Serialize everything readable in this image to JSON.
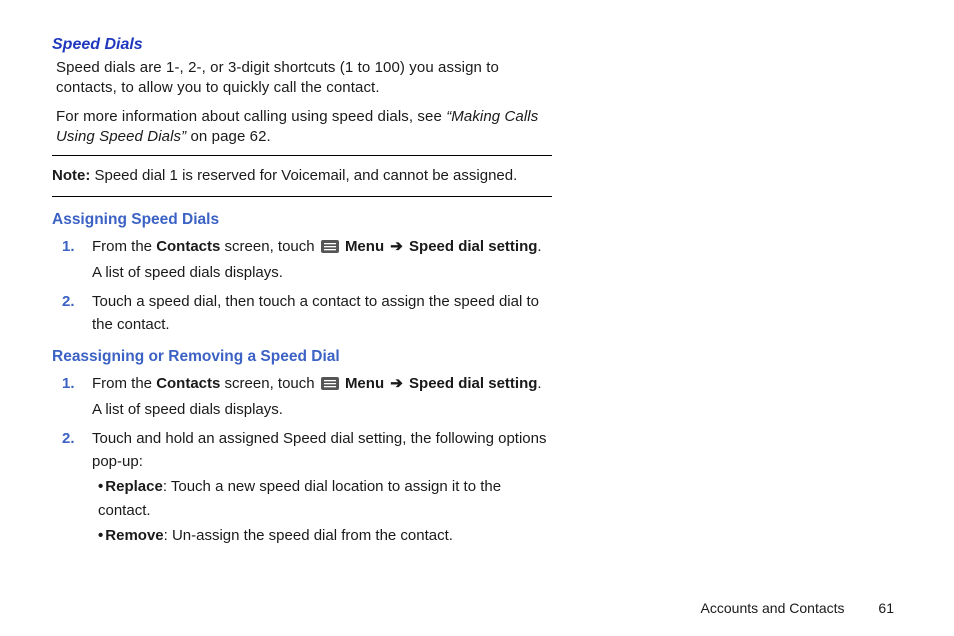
{
  "heading": "Speed Dials",
  "intro1": "Speed dials are 1-, 2-, or 3-digit shortcuts (1 to 100) you assign to contacts, to allow you to quickly call the contact.",
  "intro2_pre": "For more information about calling using speed dials, see ",
  "intro2_ref": "“Making Calls Using Speed Dials”",
  "intro2_post": " on page 62.",
  "note_label": "Note:",
  "note_text": " Speed dial 1 is reserved for Voicemail, and cannot be assigned.",
  "sub1": "Assigning Speed Dials",
  "s1_num": "1.",
  "s1_a": "From the ",
  "s1_b": "Contacts",
  "s1_c": " screen, touch ",
  "s1_d": "Menu",
  "s1_arrow": "➔",
  "s1_e": "Speed dial setting",
  "s1_f": ". A list of speed dials displays.",
  "s2_num": "2.",
  "s2": "Touch a speed dial, then touch a contact to assign the speed dial to the contact.",
  "sub2": "Reassigning or Removing a Speed Dial",
  "r1_num": "1.",
  "r1_a": "From the ",
  "r1_b": "Contacts",
  "r1_c": " screen, touch ",
  "r1_d": "Menu",
  "r1_arrow": "➔",
  "r1_e": "Speed dial setting",
  "r1_f": ". A list of speed dials displays.",
  "r2_num": "2.",
  "r2": "Touch and hold an assigned Speed dial setting, the following options pop-up:",
  "bul_dot": "•",
  "bul1_label": "Replace",
  "bul1_text": ": Touch a new speed dial location to assign it to the contact.",
  "bul2_label": "Remove",
  "bul2_text": ": Un-assign the speed dial from the contact.",
  "footer_section": "Accounts and Contacts",
  "footer_page": "61"
}
